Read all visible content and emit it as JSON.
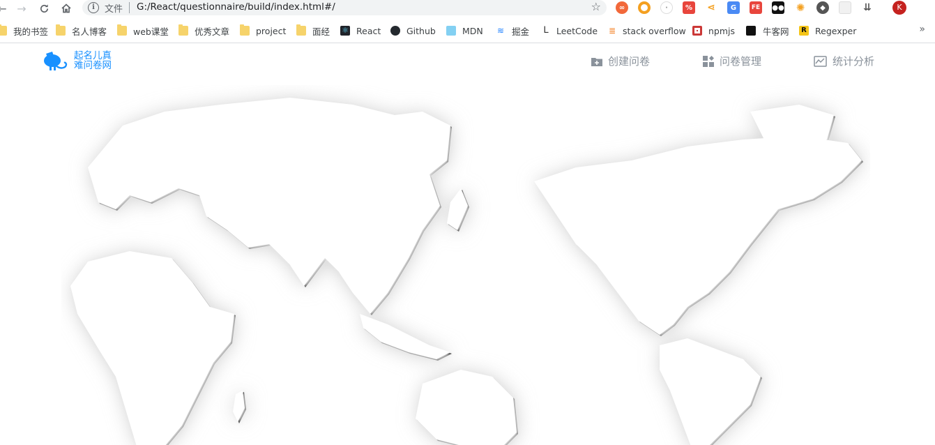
{
  "browser": {
    "url_scheme": "文件",
    "url": "G:/React/questionnaire/build/index.html#/",
    "profile_initial": "K",
    "bookmarks": [
      {
        "label": "我的书签",
        "icon": "folder-icon"
      },
      {
        "label": "名人博客",
        "icon": "folder-icon"
      },
      {
        "label": "web课堂",
        "icon": "folder-icon"
      },
      {
        "label": "优秀文章",
        "icon": "folder-icon"
      },
      {
        "label": "project",
        "icon": "folder-icon"
      },
      {
        "label": "面经",
        "icon": "folder-icon"
      },
      {
        "label": "React",
        "icon": "react-icon"
      },
      {
        "label": "Github",
        "icon": "github-icon"
      },
      {
        "label": "MDN",
        "icon": "mdn-icon"
      },
      {
        "label": "掘金",
        "icon": "juejin-icon"
      },
      {
        "label": "LeetCode",
        "icon": "leetcode-icon"
      },
      {
        "label": "stack overflow",
        "icon": "stackoverflow-icon"
      },
      {
        "label": "npmjs",
        "icon": "npm-icon"
      },
      {
        "label": "牛客网",
        "icon": "nowcoder-icon"
      },
      {
        "label": "Regexper",
        "icon": "regexper-icon"
      }
    ],
    "bookmarks_more": "»"
  },
  "app": {
    "logo_line1": "起名儿真",
    "logo_line2": "难问卷网",
    "nav": [
      {
        "label": "创建问卷",
        "icon": "create-folder-icon"
      },
      {
        "label": "问卷管理",
        "icon": "grid-manage-icon"
      },
      {
        "label": "统计分析",
        "icon": "chart-analysis-icon"
      }
    ]
  },
  "colors": {
    "brand": "#1890ff",
    "nav_text": "#8a929b",
    "map_shade": "#e8e8e8"
  }
}
